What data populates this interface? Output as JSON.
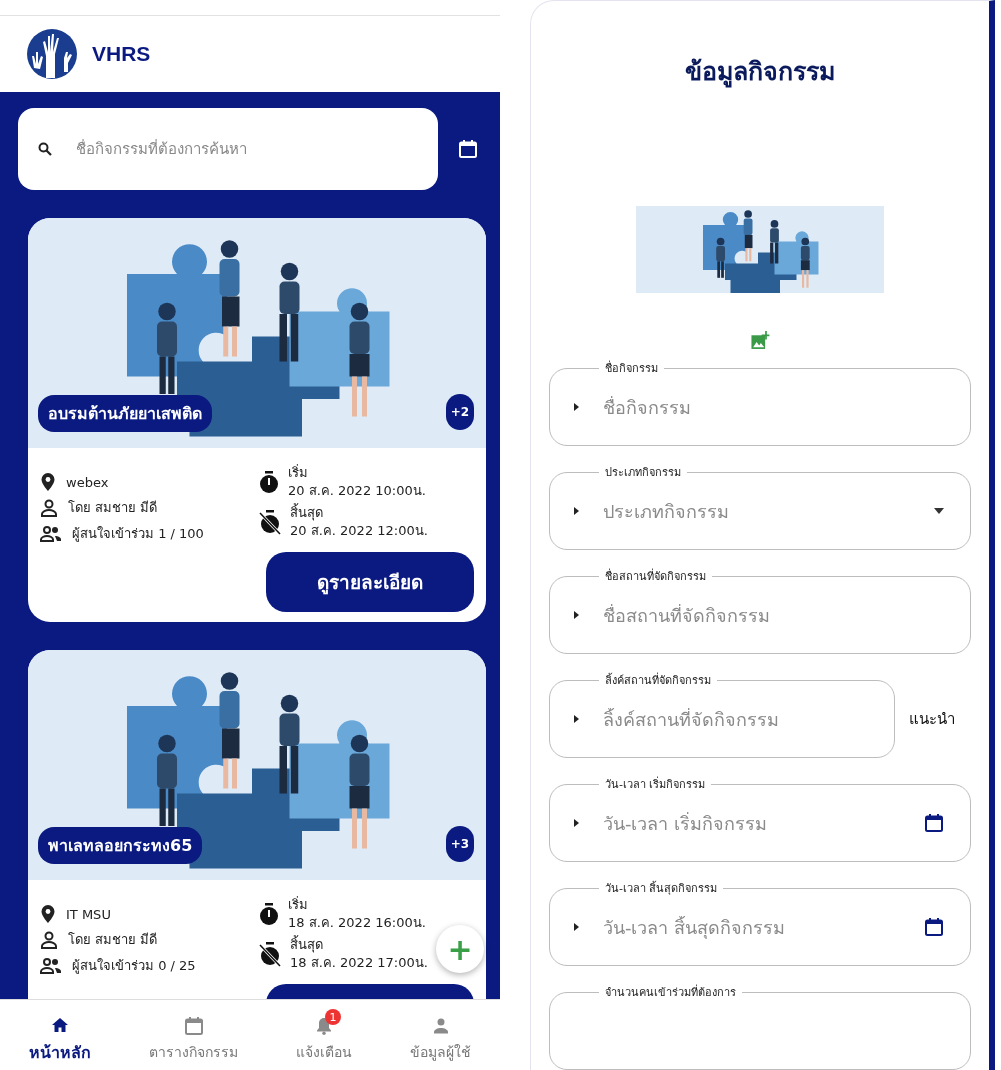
{
  "header": {
    "app_name": "VHRS"
  },
  "search": {
    "placeholder": "ชื่อกิจกรรมที่ต้องการค้นหา"
  },
  "activities": [
    {
      "title": "อบรมต้านภัยยาเสพติด",
      "more_images": "+2",
      "location": "webex",
      "organizer": "โดย สมชาย มีดี",
      "interest": "ผู้สนใจเข้าร่วม 1 / 100",
      "start_label": "เริ่ม",
      "start": "20 ส.ค. 2022 10:00น.",
      "end_label": "สิ้นสุด",
      "end": "20 ส.ค. 2022 12:00น.",
      "button": "ดูรายละเอียด"
    },
    {
      "title": "พาเลทลอยกระทง65",
      "more_images": "+3",
      "location": "IT MSU",
      "organizer": "โดย สมชาย มีดี",
      "interest": "ผู้สนใจเข้าร่วม 0 / 25",
      "start_label": "เริ่ม",
      "start": "18 ส.ค. 2022 16:00น.",
      "end_label": "สิ้นสุด",
      "end": "18 ส.ค. 2022 17:00น."
    }
  ],
  "fab": {
    "label": "+"
  },
  "bottom_nav": [
    {
      "kind": "home",
      "label": "หน้าหลัก",
      "selected": true
    },
    {
      "kind": "calendar",
      "label": "ตารางกิจกรรม",
      "selected": false
    },
    {
      "kind": "bell",
      "label": "แจ้งเตือน",
      "selected": false,
      "badge": "1"
    },
    {
      "kind": "person",
      "label": "ข้อมูลผู้ใช้",
      "selected": false
    }
  ],
  "form": {
    "title": "ข้อมูลกิจกรรม",
    "fields": [
      {
        "kind": "text",
        "label": "ชื่อกิจกรรม",
        "placeholder": "ชื่อกิจกรรม"
      },
      {
        "kind": "select",
        "label": "ประเภทกิจกรรม",
        "placeholder": "ประเภทกิจกรรม"
      },
      {
        "kind": "text",
        "label": "ชื่อสถานที่จัดกิจกรรม",
        "placeholder": "ชื่อสถานที่จัดกิจกรรม"
      },
      {
        "kind": "link",
        "label": "ลิ้งค์สถานที่จัดกิจกรรม",
        "placeholder": "ลิ้งค์สถานที่จัดกิจกรรม",
        "action": "แนะนำ"
      },
      {
        "kind": "date",
        "label": "วัน-เวลา เริ่มกิจกรรม",
        "placeholder": "วัน-เวลา เริ่มกิจกรรม"
      },
      {
        "kind": "date",
        "label": "วัน-เวลา สิ้นสุดกิจกรรม",
        "placeholder": "วัน-เวลา สิ้นสุดกิจกรรม"
      },
      {
        "kind": "text",
        "label": "จำนวนคนเข้าร่วมที่ต้องการ"
      }
    ]
  }
}
